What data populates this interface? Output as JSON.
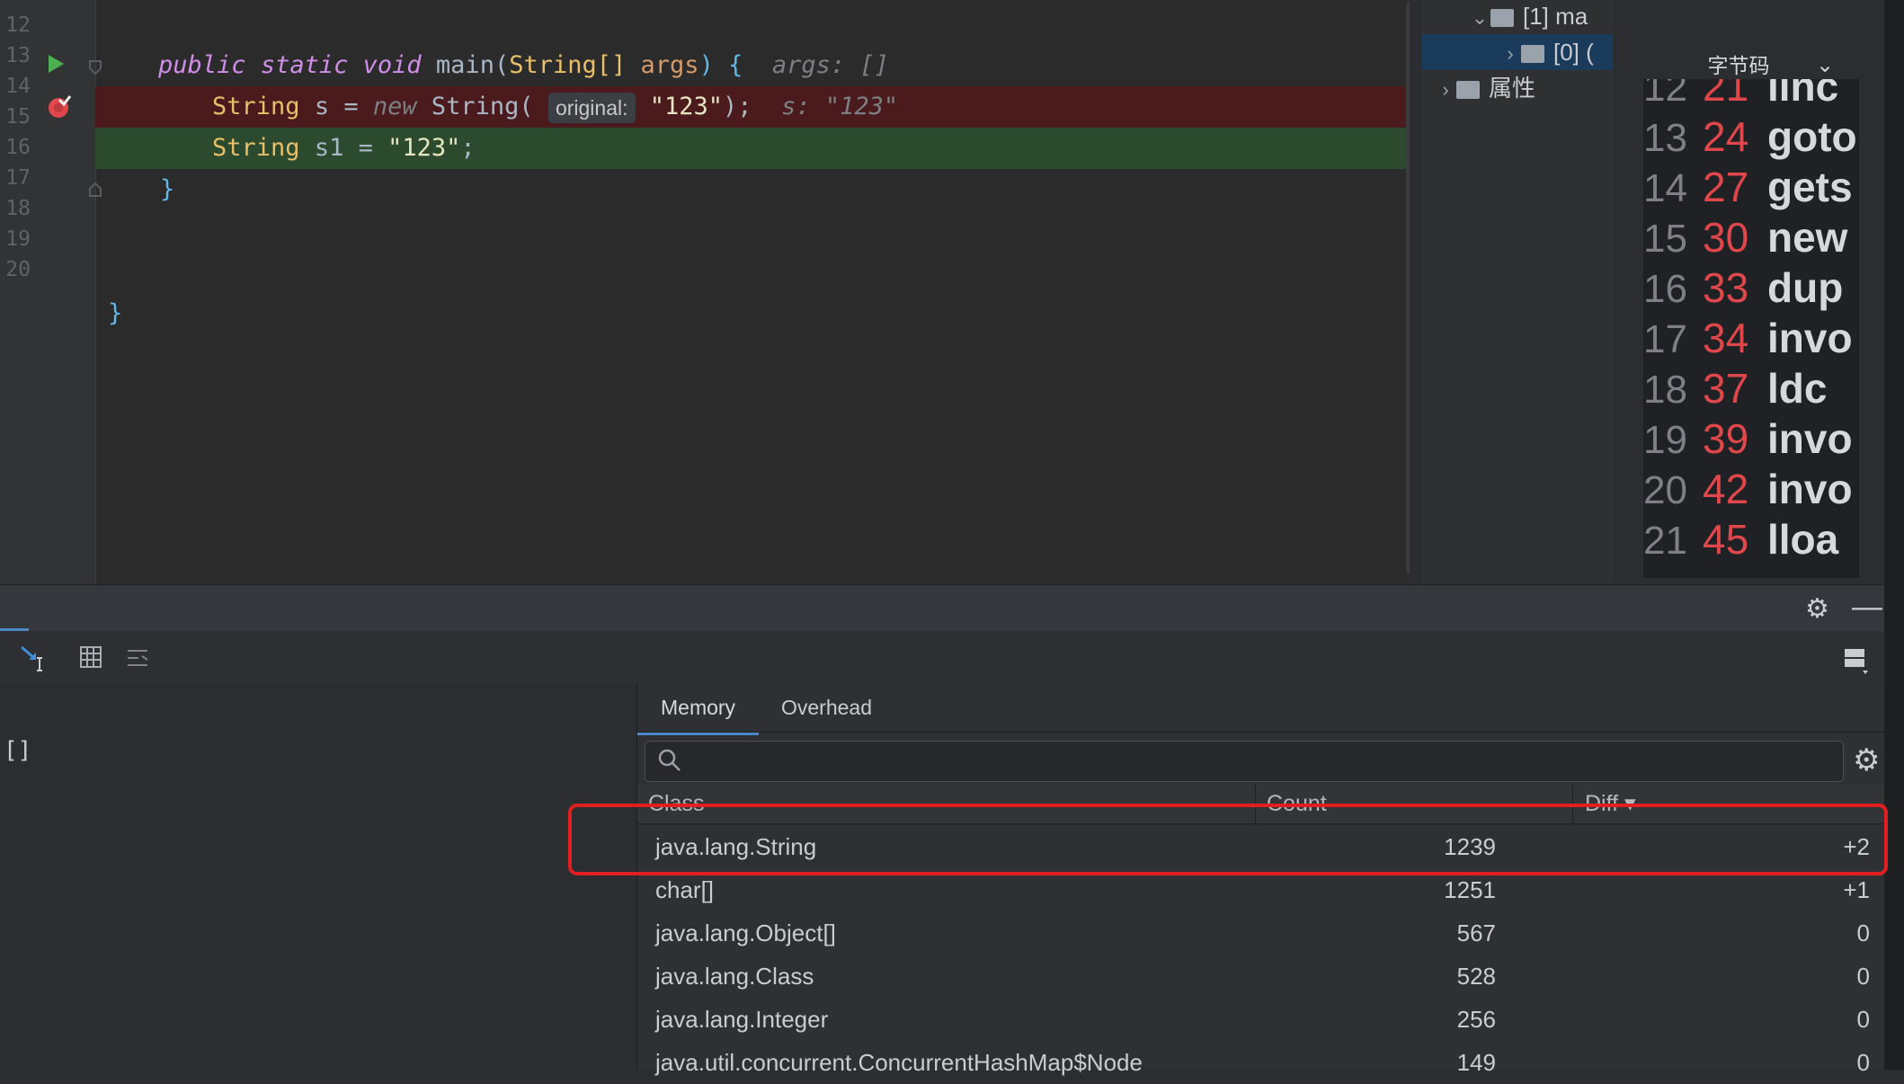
{
  "editor": {
    "lines": [
      {
        "no": "12"
      },
      {
        "no": "13"
      },
      {
        "no": "14"
      },
      {
        "no": "15"
      },
      {
        "no": "16"
      },
      {
        "no": "17"
      },
      {
        "no": "18"
      },
      {
        "no": "19"
      },
      {
        "no": "20"
      }
    ],
    "line13": {
      "public": "public",
      "static": "static",
      "void": "void",
      "fname": "main",
      "open": "(",
      "ptype": "String[]",
      "pname": "args",
      "close": ") {",
      "hint": "args: []"
    },
    "line14": {
      "type": "String",
      "var": "s = ",
      "new": "new",
      "ctor": "String(",
      "inlay": "original:",
      "arg": "\"123\"",
      "end": ");",
      "hint": "s: \"123\""
    },
    "line15": {
      "type": "String",
      "var": "s1 = ",
      "arg": "\"123\"",
      "end": ";"
    },
    "line16": {
      "brace": "}"
    },
    "line19": {
      "brace": "}"
    }
  },
  "tree": {
    "rows": [
      {
        "label": "[1] ma"
      },
      {
        "label": "[0] ("
      },
      {
        "label": "属性"
      }
    ]
  },
  "bytecode": {
    "tab_label": "字节码",
    "rows": [
      {
        "no": "12",
        "off": "21",
        "op": "linc"
      },
      {
        "no": "13",
        "off": "24",
        "op": "goto"
      },
      {
        "no": "14",
        "off": "27",
        "op": "gets"
      },
      {
        "no": "15",
        "off": "30",
        "op": "new"
      },
      {
        "no": "16",
        "off": "33",
        "op": "dup"
      },
      {
        "no": "17",
        "off": "34",
        "op": "invo"
      },
      {
        "no": "18",
        "off": "37",
        "op": "ldc"
      },
      {
        "no": "19",
        "off": "39",
        "op": "invo"
      },
      {
        "no": "20",
        "off": "42",
        "op": "invo"
      },
      {
        "no": "21",
        "off": "45",
        "op": "lloa"
      }
    ]
  },
  "left_pane": {
    "value": "[]"
  },
  "memory": {
    "tabs": [
      {
        "label": "Memory"
      },
      {
        "label": "Overhead"
      }
    ],
    "search_placeholder": "",
    "columns": {
      "class": "Class",
      "count": "Count",
      "diff": "Diff ▾"
    },
    "rows": [
      {
        "class": "java.lang.String",
        "count": "1239",
        "diff": "+2"
      },
      {
        "class": "char[]",
        "count": "1251",
        "diff": "+1"
      },
      {
        "class": "java.lang.Object[]",
        "count": "567",
        "diff": "0"
      },
      {
        "class": "java.lang.Class",
        "count": "528",
        "diff": "0"
      },
      {
        "class": "java.lang.Integer",
        "count": "256",
        "diff": "0"
      },
      {
        "class": "java.util.concurrent.ConcurrentHashMap$Node",
        "count": "149",
        "diff": "0"
      }
    ]
  },
  "colors": {
    "highlight": "#e02020",
    "accent": "#4a88c7",
    "breakpoint_line": "#4a1a1c",
    "current_line": "#2b4a2e"
  },
  "icons": [
    "run-arrow-icon",
    "breakpoint-icon",
    "fold-icon",
    "folder-icon",
    "chevron-icon",
    "gear-icon",
    "minimize-icon",
    "search-icon"
  ]
}
